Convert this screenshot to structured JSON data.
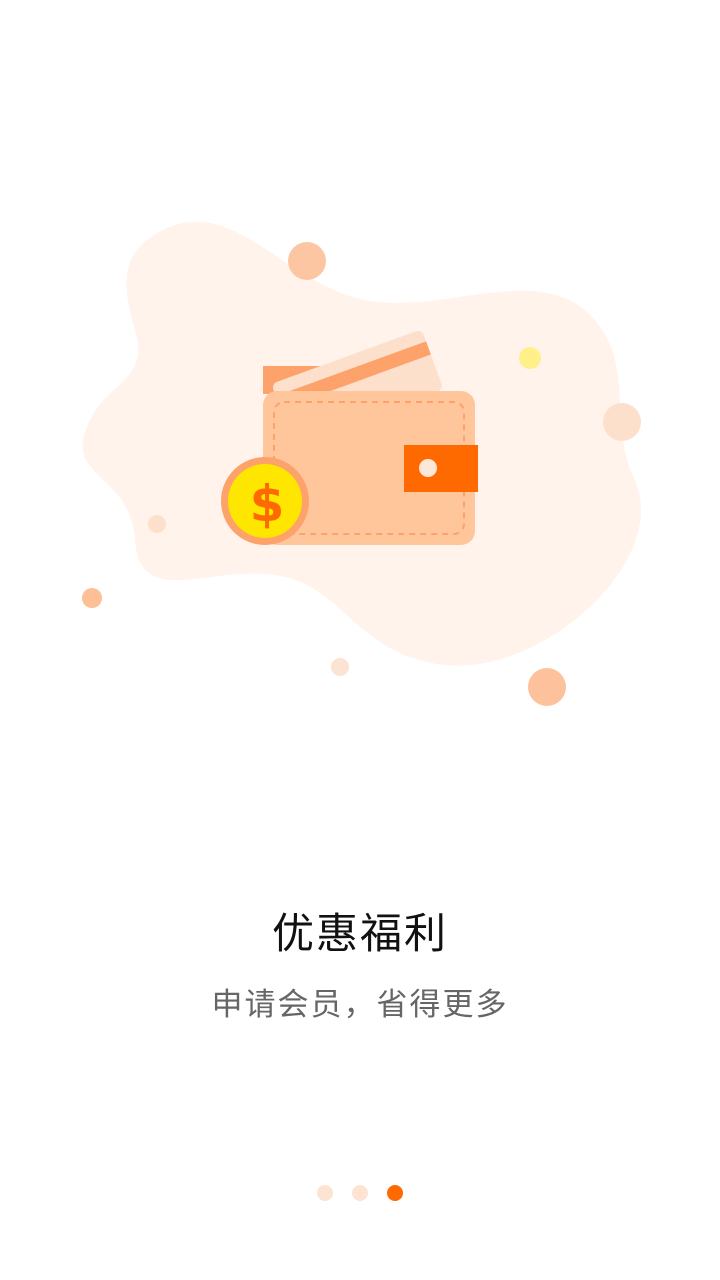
{
  "onboarding": {
    "title": "优惠福利",
    "subtitle": "申请会员，省得更多",
    "illustration_icon": "wallet-coin-illustration",
    "coin_symbol": "$",
    "pagination": {
      "total": 3,
      "active_index": 2
    }
  },
  "colors": {
    "accent": "#ff6a00",
    "dot_inactive": "#fde3d2",
    "blob_background": "#fff3ec",
    "wallet_body": "#ffc69c",
    "coin_yellow": "#ffe600"
  }
}
